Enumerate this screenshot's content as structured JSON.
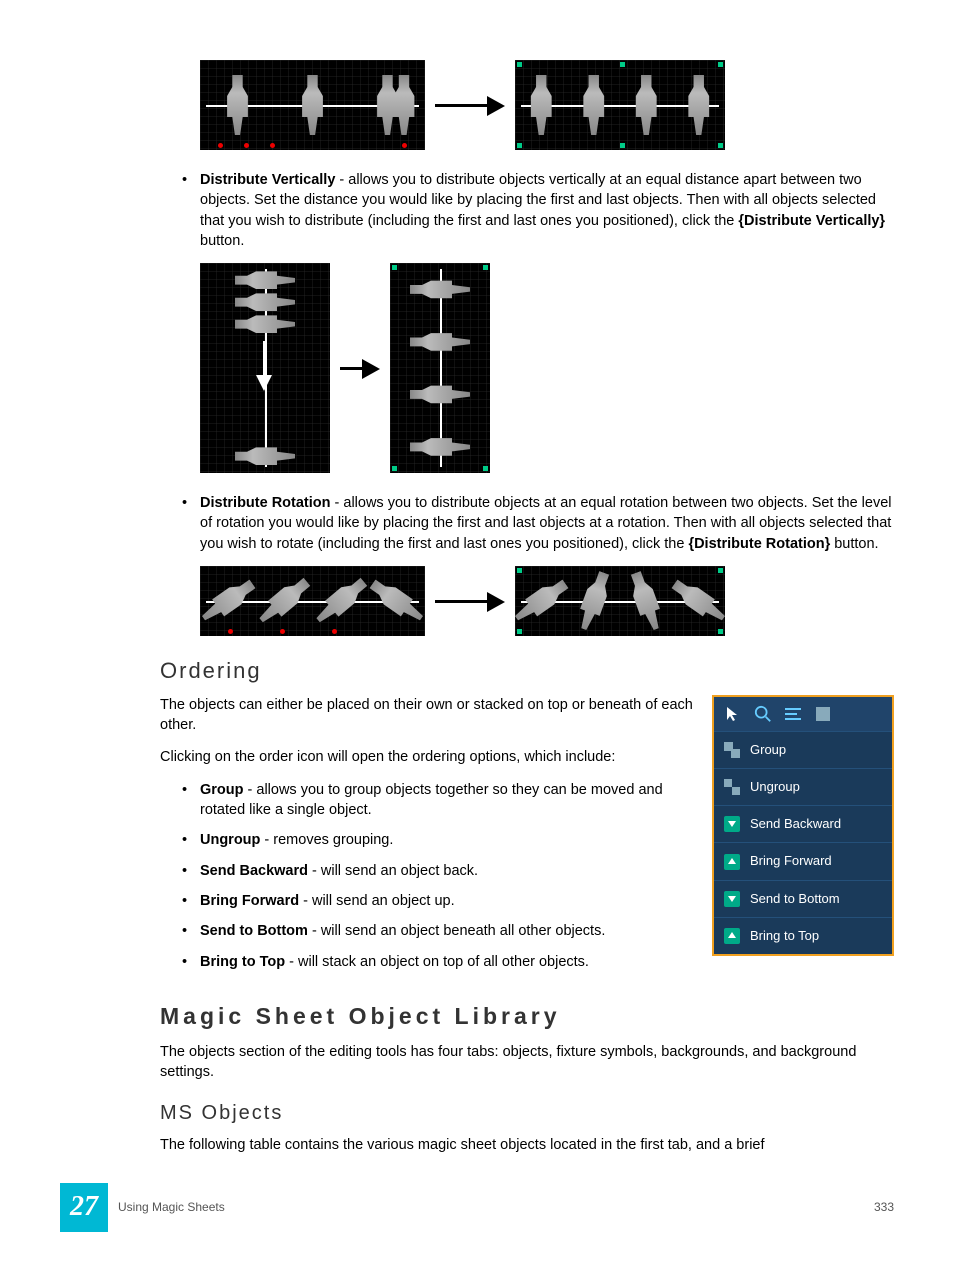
{
  "bullets": {
    "distVert": {
      "term": "Distribute Vertically",
      "text": " - allows you to distribute objects vertically at an equal distance apart between two objects. Set the distance you would like by placing the first and last objects. Then with all objects selected that you wish to distribute (including the first and last ones you positioned), click the ",
      "btn": "{Distribute Vertically}",
      "after": " button."
    },
    "distRot": {
      "term": "Distribute Rotation",
      "text": " - allows you to distribute objects at an equal rotation between two objects. Set the level of rotation you would like by placing the first and last objects at a rotation. Then with all objects selected that you wish to rotate (including the first and last ones you positioned), click the ",
      "btn": "{Distribute Rotation}",
      "after": " button."
    }
  },
  "ordering": {
    "heading": "Ordering",
    "intro1": "The objects can either be placed on their own or stacked on top or beneath of each other.",
    "intro2": "Clicking on the order icon will open the ordering options, which include:",
    "items": [
      {
        "term": "Group",
        "text": " - allows you to group objects together so they can be moved and rotated like a single object."
      },
      {
        "term": "Ungroup",
        "text": " - removes grouping."
      },
      {
        "term": "Send Backward",
        "text": " - will send an object back."
      },
      {
        "term": "Bring Forward",
        "text": " - will send an object up."
      },
      {
        "term": "Send to Bottom",
        "text": " - will send an object beneath all other objects."
      },
      {
        "term": "Bring to Top",
        "text": " - will stack an object on top of all other objects."
      }
    ]
  },
  "panel": {
    "items": [
      {
        "label": "Group",
        "icon": "group"
      },
      {
        "label": "Ungroup",
        "icon": "ungroup"
      },
      {
        "label": "Send Backward",
        "icon": "down"
      },
      {
        "label": "Bring Forward",
        "icon": "up"
      },
      {
        "label": "Send to Bottom",
        "icon": "down"
      },
      {
        "label": "Bring to Top",
        "icon": "up"
      }
    ]
  },
  "library": {
    "heading": "Magic Sheet Object Library",
    "intro": "The objects section of the editing tools has four tabs: objects, fixture symbols, backgrounds, and background settings.",
    "sub": "MS Objects",
    "subtext": "The following table contains the various magic sheet objects located in the first tab, and a brief"
  },
  "footer": {
    "chapter": "27",
    "section": "Using Magic Sheets",
    "page": "333"
  }
}
